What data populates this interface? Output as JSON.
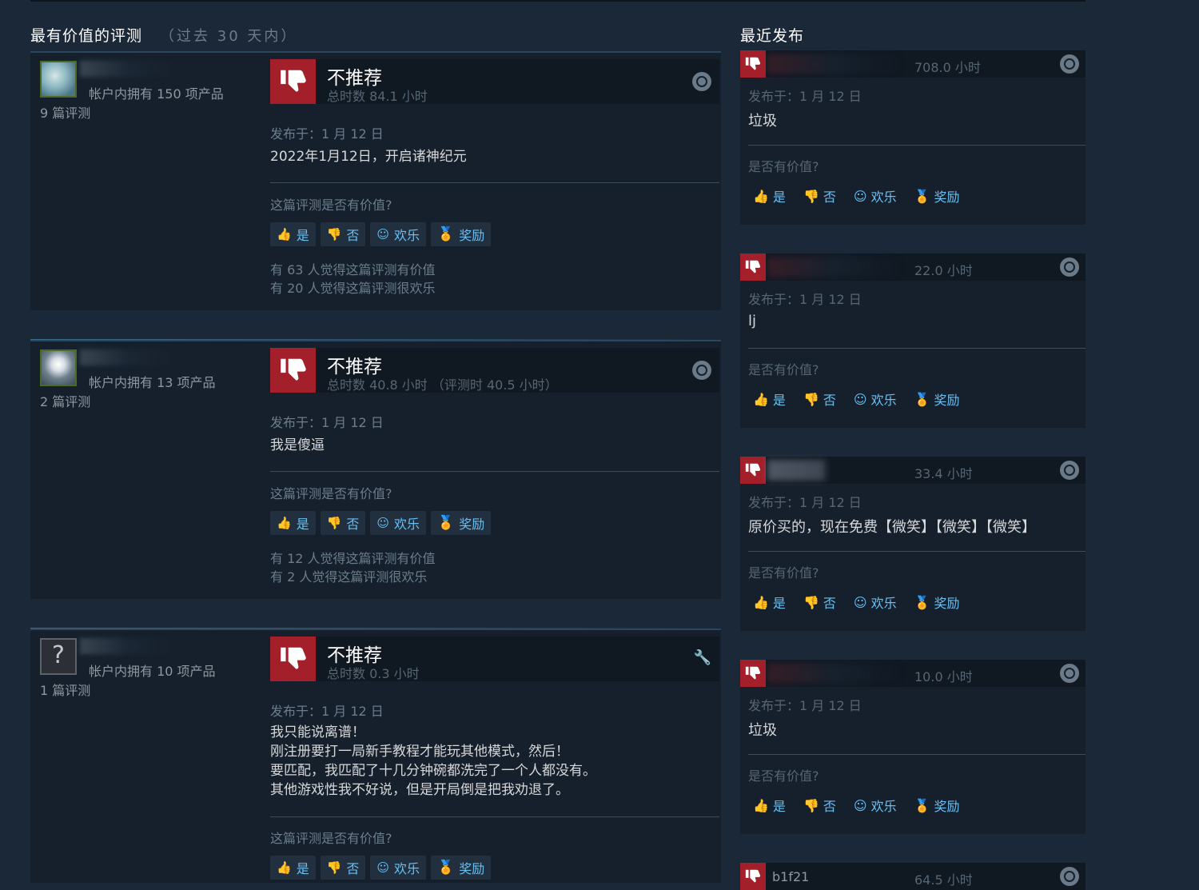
{
  "most_helpful": {
    "title": "最有价值的评测",
    "subtitle": "（过去 30 天内）"
  },
  "recent": {
    "title": "最近发布"
  },
  "left_reviews": [
    {
      "owned": "帐户内拥有 150 项产品",
      "review_count": "9 篇评测",
      "verdict": "不推荐",
      "hours": "总时数 84.1 小时",
      "posted": "发布于：1 月 12 日",
      "content": "2022年1月12日，开启诸神纪元",
      "helpful_question": "这篇评测是否有价值?",
      "buttons": {
        "yes": "是",
        "no": "否",
        "funny": "欢乐",
        "award": "奖励"
      },
      "stats": [
        "有 63 人觉得这篇评测有价值",
        "有 20 人觉得这篇评测很欢乐"
      ]
    },
    {
      "owned": "帐户内拥有 13 项产品",
      "review_count": "2 篇评测",
      "verdict": "不推荐",
      "hours": "总时数 40.8 小时 （评测时 40.5 小时）",
      "posted": "发布于：1 月 12 日",
      "content": "我是傻逼",
      "helpful_question": "这篇评测是否有价值?",
      "buttons": {
        "yes": "是",
        "no": "否",
        "funny": "欢乐",
        "award": "奖励"
      },
      "stats": [
        "有 12 人觉得这篇评测有价值",
        "有 2 人觉得这篇评测很欢乐"
      ]
    },
    {
      "owned": "帐户内拥有 10 项产品",
      "review_count": "1 篇评测",
      "verdict": "不推荐",
      "hours": "总时数 0.3 小时",
      "posted": "发布于：1 月 12 日",
      "content": "我只能说离谱！\n刚注册要打一局新手教程才能玩其他模式，然后！\n要匹配，我匹配了十几分钟碗都洗完了一个人都没有。\n其他游戏性我不好说，但是开局倒是把我劝退了。",
      "helpful_question": "这篇评测是否有价值?",
      "buttons": {
        "yes": "是",
        "no": "否",
        "funny": "欢乐",
        "award": "奖励"
      },
      "avatar_glyph": "?"
    }
  ],
  "right_reviews": [
    {
      "name": "",
      "hours": "708.0 小时",
      "posted": "发布于：1 月 12 日",
      "content": "垃圾",
      "helpful_question": "是否有价值?"
    },
    {
      "name": "",
      "hours": "22.0 小时",
      "posted": "发布于：1 月 12 日",
      "content": "lj",
      "helpful_question": "是否有价值?"
    },
    {
      "name": "",
      "hours": "33.4 小时",
      "posted": "发布于：1 月 12 日",
      "content": "原价买的，现在免费【微笑】【微笑】【微笑】",
      "helpful_question": "是否有价值?"
    },
    {
      "name": "",
      "hours": "10.0 小时",
      "posted": "发布于：1 月 12 日",
      "content": "垃圾",
      "helpful_question": "是否有价值?"
    },
    {
      "name": "b1f21",
      "hours": "64.5 小时"
    }
  ],
  "right_buttons": {
    "yes": "是",
    "no": "否",
    "funny": "欢乐",
    "award": "奖励"
  },
  "colors": {
    "background": "#1b2838",
    "card": "#16202d",
    "thumb_down": "#a3202b",
    "link": "#66c0f4",
    "award": "#f5c518"
  }
}
